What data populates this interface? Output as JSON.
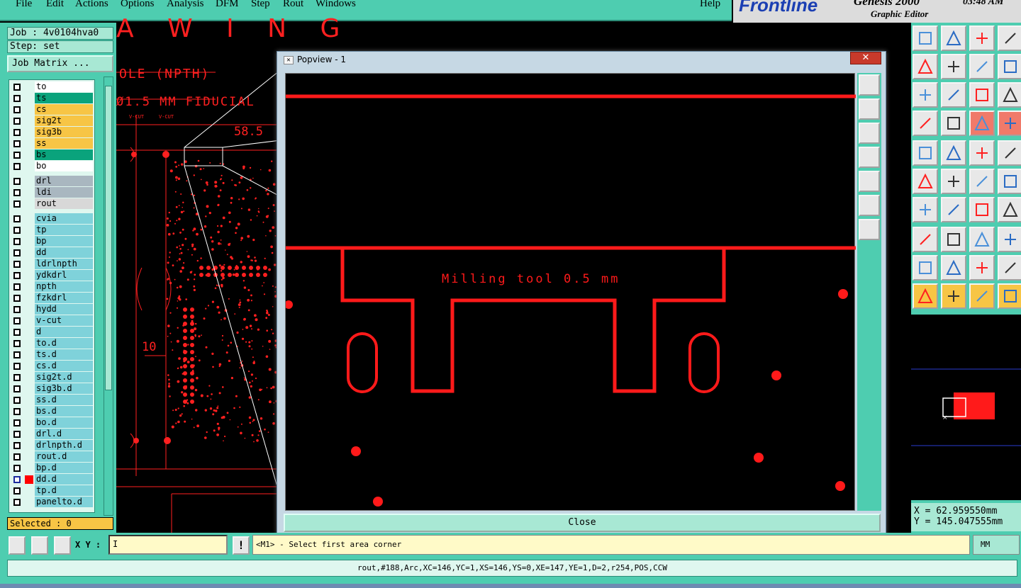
{
  "menubar": {
    "items": [
      "File",
      "Edit",
      "Actions",
      "Options",
      "Analysis",
      "DFM",
      "Step",
      "Rout",
      "Windows"
    ],
    "help": "Help"
  },
  "brand": {
    "logo": "Frontline",
    "product": "Genesis 2000",
    "subtitle": "Graphic Editor",
    "time": "03:48 AM"
  },
  "job": {
    "job": "Job : 4v0104hva0",
    "step": "Step: set",
    "matrix_button": "Job Matrix ..."
  },
  "layers": [
    {
      "name": "to",
      "color": "#ffffff"
    },
    {
      "name": "ts",
      "color": "#0aa37c"
    },
    {
      "name": "cs",
      "color": "#f7c545"
    },
    {
      "name": "sig2t",
      "color": "#f7c545"
    },
    {
      "name": "sig3b",
      "color": "#f7c545"
    },
    {
      "name": "ss",
      "color": "#f7c545"
    },
    {
      "name": "bs",
      "color": "#0aa37c"
    },
    {
      "name": "bo",
      "color": "#ffffff"
    },
    {
      "name": "drl",
      "color": "#a9b7c0"
    },
    {
      "name": "ldi",
      "color": "#a9b7c0"
    },
    {
      "name": "rout",
      "color": "#d8d8d8"
    },
    {
      "name": "cvia",
      "color": "#7fd2da"
    },
    {
      "name": "tp",
      "color": "#7fd2da"
    },
    {
      "name": "bp",
      "color": "#7fd2da"
    },
    {
      "name": "dd",
      "color": "#7fd2da"
    },
    {
      "name": "ldrlnpth",
      "color": "#7fd2da"
    },
    {
      "name": "ydkdrl",
      "color": "#7fd2da"
    },
    {
      "name": "npth",
      "color": "#7fd2da"
    },
    {
      "name": "fzkdrl",
      "color": "#7fd2da"
    },
    {
      "name": "hydd",
      "color": "#7fd2da"
    },
    {
      "name": "v-cut",
      "color": "#7fd2da"
    },
    {
      "name": "d",
      "color": "#7fd2da"
    },
    {
      "name": "to.d",
      "color": "#7fd2da"
    },
    {
      "name": "ts.d",
      "color": "#7fd2da"
    },
    {
      "name": "cs.d",
      "color": "#7fd2da"
    },
    {
      "name": "sig2t.d",
      "color": "#7fd2da"
    },
    {
      "name": "sig3b.d",
      "color": "#7fd2da"
    },
    {
      "name": "ss.d",
      "color": "#7fd2da"
    },
    {
      "name": "bs.d",
      "color": "#7fd2da"
    },
    {
      "name": "bo.d",
      "color": "#7fd2da"
    },
    {
      "name": "drl.d",
      "color": "#7fd2da"
    },
    {
      "name": "drlnpth.d",
      "color": "#7fd2da"
    },
    {
      "name": "rout.d",
      "color": "#7fd2da"
    },
    {
      "name": "bp.d",
      "color": "#7fd2da"
    },
    {
      "name": "dd.d",
      "color": "#7fd2da"
    },
    {
      "name": "tp.d",
      "color": "#7fd2da"
    },
    {
      "name": "panelto.d",
      "color": "#7fd2da"
    }
  ],
  "selected": "Selected : 0",
  "canvas": {
    "title_text": "A W I N G",
    "npth": "OLE (NPTH)",
    "fiducial": "Ø1.5 MM FIDUCIAL",
    "dim_58": "58.5",
    "dim_10": "10",
    "vcut": "V-CUT"
  },
  "popview": {
    "title": "Popview - 1",
    "close_label": "Close",
    "milling_text": "Milling tool 0.5 mm"
  },
  "coords": {
    "x": "X =  62.959550mm",
    "y": "Y = 145.047555mm"
  },
  "command": {
    "xy_label": "X Y :",
    "xy_value": "I",
    "prompt": "<M1> - Select first area corner",
    "units": "MM"
  },
  "status": "rout,#188,Arc,XC=146,YC=1,XS=146,YS=0,XE=147,YE=1,D=2,r254,POS,CCW",
  "colors": {
    "accent": "#4ecdb0",
    "drawing": "#ff0000",
    "active_layer": "#ff0000"
  }
}
